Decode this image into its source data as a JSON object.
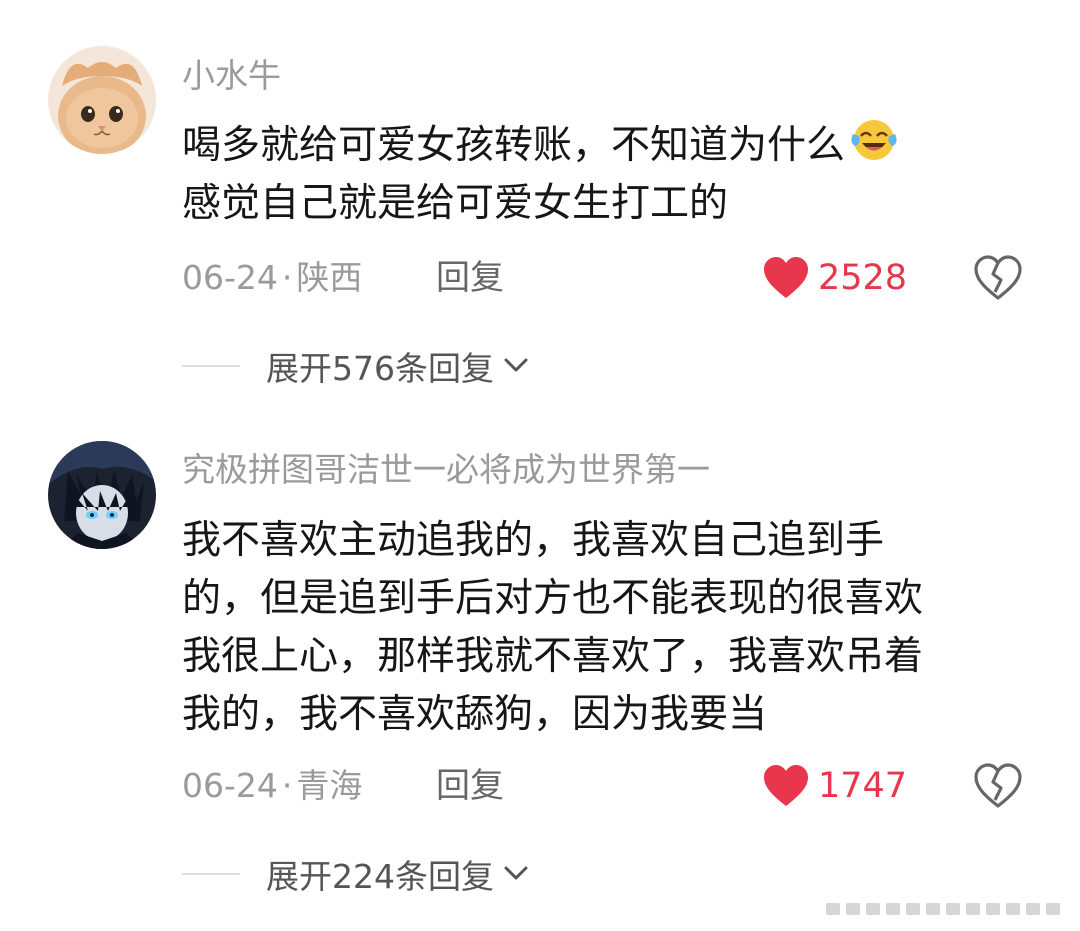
{
  "comments": [
    {
      "username": "小水牛",
      "avatar_icon": "cat-avatar-icon",
      "lines": [
        "喝多就给可爱女孩转账，不知道为什么",
        "感觉自己就是给可爱女生打工的"
      ],
      "emoji": "crying-laughing-emoji-icon",
      "date": "06-24",
      "separator": "·",
      "location": "陕西",
      "reply_label": "回复",
      "likes": "2528",
      "expand_label": "展开576条回复"
    },
    {
      "username": "究极拼图哥洁世一必将成为世界第一",
      "avatar_icon": "anime-character-avatar-icon",
      "lines": [
        "我不喜欢主动追我的，我喜欢自己追到手",
        "的，但是追到手后对方也不能表现的很喜欢",
        "我很上心，那样我就不喜欢了，我喜欢吊着",
        "我的，我不喜欢舔狗，因为我要当"
      ],
      "date": "06-24",
      "separator": "·",
      "location": "青海",
      "reply_label": "回复",
      "likes": "1747",
      "expand_label": "展开224条回复"
    }
  ],
  "colors": {
    "like_red": "#e8364c",
    "meta_gray": "#9a9a9a",
    "text": "#161616"
  }
}
